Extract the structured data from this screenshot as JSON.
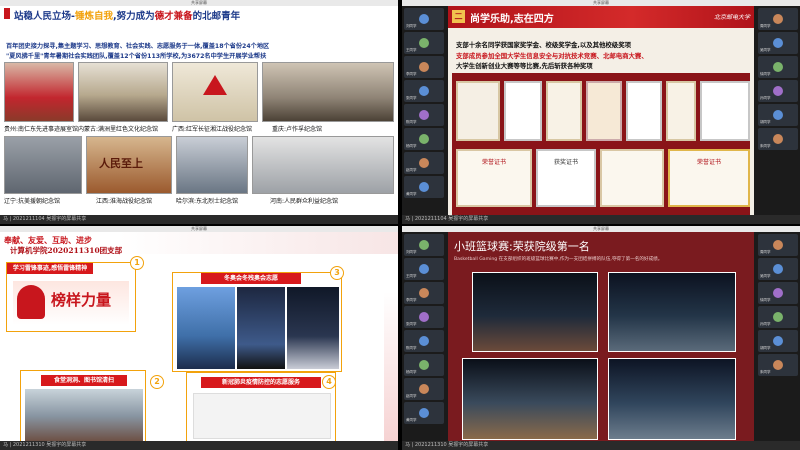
{
  "q1": {
    "window_title": "共享屏幕",
    "title_left": "站稳人民立场-",
    "title_mid": "锤炼自我",
    "title_right": ",努力成为",
    "title_red": "德才兼备",
    "title_end": "的北邮青年",
    "line1": "百年团史接力探寻,集主题学习、思想教育、社会实践、志愿服务于一体,覆盖18个省份24个地区",
    "line2": "\"夏风拂千里\"青年暑期社会实践团队,覆盖12个省份113所学校,为3672名中学生开展学业帮扶",
    "captions": [
      "贵州:南仁东先进事迹展室馆",
      "内蒙古:满洲里红色文化纪念馆",
      "广西:红军长征湘江战役纪念馆",
      "重庆:卢作孚纪念馆",
      "辽宁:抗美援朝纪念馆",
      "江西:淮海战役纪念馆",
      "哈尔滨:东北烈士纪念馆",
      "河南:人民群众利益纪念馆"
    ],
    "footer": "马 | 2021211104 吴振宇的屏幕共享",
    "photo_text": "人民至上"
  },
  "q2": {
    "window_title": "共享屏幕",
    "badge": "二",
    "title": "尚学乐助,志在四方",
    "logo_text": "北京邮电大学",
    "line1": "支部十余名同学获国家奖学金、校级奖学金,以及其他校级奖项",
    "line2": "支部成员参加全国大学生信息安全与对抗技术竞赛、北邮电商大赛、",
    "line3": "大学生创新创业大赛等等比赛,先后斩获各种奖项",
    "cert_titles": [
      "荣誉证书",
      "获奖证书",
      "荣誉证书"
    ],
    "footer": "马 | 2021211104 吴振宇的屏幕共享",
    "participants": [
      "刘同学",
      "王同学",
      "李同学",
      "张同学",
      "陈同学",
      "杨同学",
      "赵同学",
      "黄同学",
      "周同学",
      "吴同学",
      "徐同学",
      "孙同学",
      "胡同学",
      "朱同学"
    ]
  },
  "q3": {
    "window_title": "共享屏幕",
    "slogan": "奉献、友爱、互助、进步",
    "subtitle": "计算机学院2020211310团支部",
    "box1_head": "学习雷锋事迹,感悟雷锋精神",
    "box1_text": "榜样力量",
    "box2_head": "食堂洞洞、图书馆清扫",
    "box3_head": "冬奥会冬残奥会志愿",
    "box4_head": "新冠肺炎疫情防控的志愿服务",
    "nums": [
      "1",
      "2",
      "3",
      "4"
    ],
    "footer": "马 | 2021211310 吴振宇的屏幕共享"
  },
  "q4": {
    "window_title": "共享屏幕",
    "title": "小班篮球赛:荣获院级第一名",
    "subtitle": "Basketball Gaming 在支部组织的班级篮球比赛中,作为一支团结拼搏的队伍,夺得了第一名的好成绩。",
    "footer": "马 | 2021211310 吴振宇的屏幕共享",
    "participants": [
      "刘同学",
      "王同学",
      "李同学",
      "张同学",
      "陈同学",
      "杨同学",
      "赵同学",
      "黄同学",
      "周同学",
      "吴同学",
      "徐同学",
      "孙同学",
      "胡同学",
      "朱同学"
    ]
  },
  "colors": {
    "red": "#c8161d",
    "orange": "#f2a20c",
    "navy": "#1d3a8a"
  }
}
